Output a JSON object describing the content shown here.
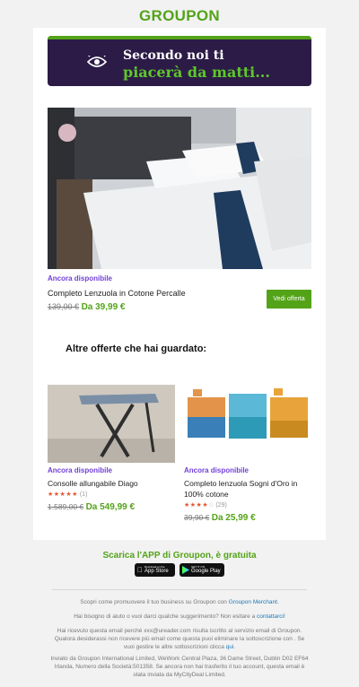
{
  "header": {
    "logo": "GROUPON"
  },
  "banner": {
    "line1": "Secondo noi ti",
    "line2": "piacerà da matti..."
  },
  "hero": {
    "availability": "Ancora disponibile",
    "title": "Completo Lenzuola in Cotone Percalle",
    "old_price": "139,00 €",
    "new_price": "Da 39,99 €",
    "cta": "Vedi offerta"
  },
  "section": {
    "title": "Altre offerte che hai guardato:"
  },
  "items": [
    {
      "availability": "Ancora disponibile",
      "title": "Consolle allungabile Diago",
      "stars": "★★★★★",
      "stars_empty": "",
      "review_count": "(1)",
      "old_price": "1.589,00 €",
      "new_price": "Da 549,99 €"
    },
    {
      "availability": "Ancora disponibile",
      "title": "Completo lenzuola Sogni d'Oro in 100% cotone",
      "stars": "★★★★",
      "stars_empty": "☆",
      "review_count": "(29)",
      "old_price": "39,90 €",
      "new_price": "Da 25,99 €"
    }
  ],
  "app": {
    "title": "Scarica l'APP di Groupon, è gratuita",
    "appstore_small": "Download on the",
    "appstore_big": "App Store",
    "googleplay_small": "GET IT ON",
    "googleplay_big": "Google Play"
  },
  "footer": {
    "merchant_text": "Scopri come promuovere il tuo business su Groupon con ",
    "merchant_link": "Groupon Merchant",
    "merchant_end": ".",
    "help_text": "Hai bisogno di aiuto o vuoi darci qualche suggerimento? Non esitare a ",
    "help_link": "contattarci!",
    "info_text": "Hai ricevuto questa email perché xxx@ureader.com risulta iscritto al servizio email di Groupon. Qualora desiderassi non ricevere più email come questa puoi eliminare la sottoscrizione con . Se vuoi gestire le altre sottoscrizioni clicca ",
    "info_link": "qui",
    "info_end": ".",
    "legal_text": "Inviato da Groupon International Limited, WeWork Central Plaza, 36 Dame Street, Dublin D02 EF64 Irlanda, Numero della Società:501358. Se ancora non hai trasferito il tuo account, questa email è stata inviata da MyCityDeal Limited."
  },
  "colors": {
    "brand_green": "#53a318",
    "banner_bg": "#2c1b47",
    "accent_purple": "#7140d6",
    "star": "#e4572e"
  }
}
